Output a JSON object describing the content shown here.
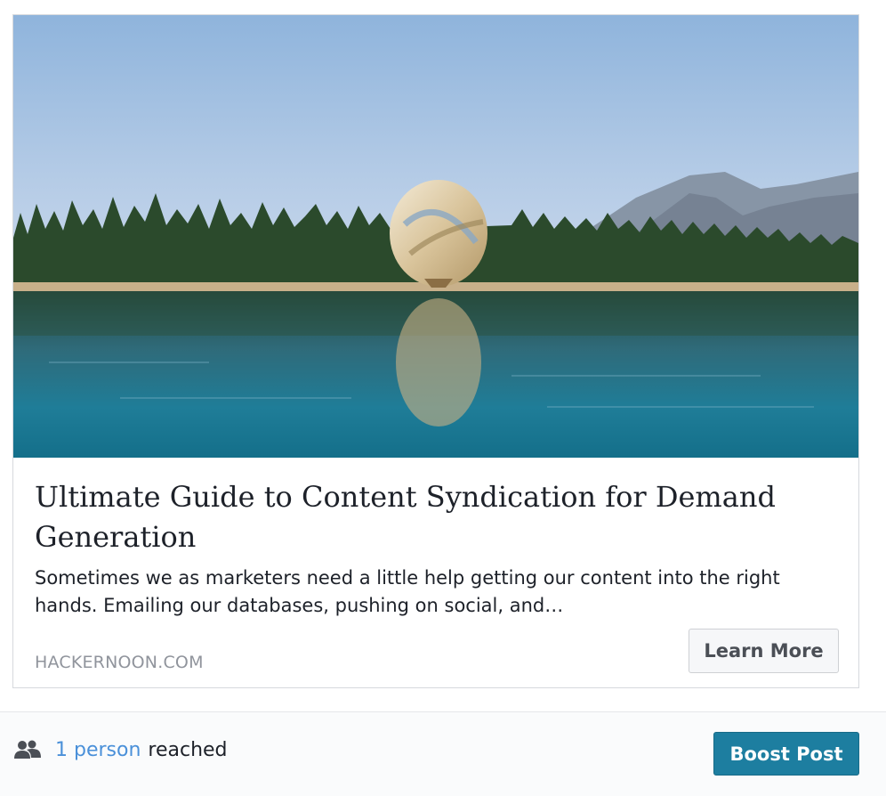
{
  "link_card": {
    "image_description": "hot-air-balloon-over-lake-photo",
    "title": "Ultimate Guide to Content Syndication for Demand Generation",
    "description": "Sometimes we as marketers need a little help getting our content into the right hands. Emailing our databases, pushing on social, and…",
    "domain": "HACKERNOON.COM",
    "cta_label": "Learn More"
  },
  "footer": {
    "reach_icon": "people-icon",
    "reach_count": "1 person",
    "reach_label": "reached",
    "boost_label": "Boost Post"
  },
  "colors": {
    "link_blue": "#4a90d9",
    "boost_button": "#1d7ea0",
    "text_dark": "#1d2129",
    "text_muted": "#90949c"
  }
}
